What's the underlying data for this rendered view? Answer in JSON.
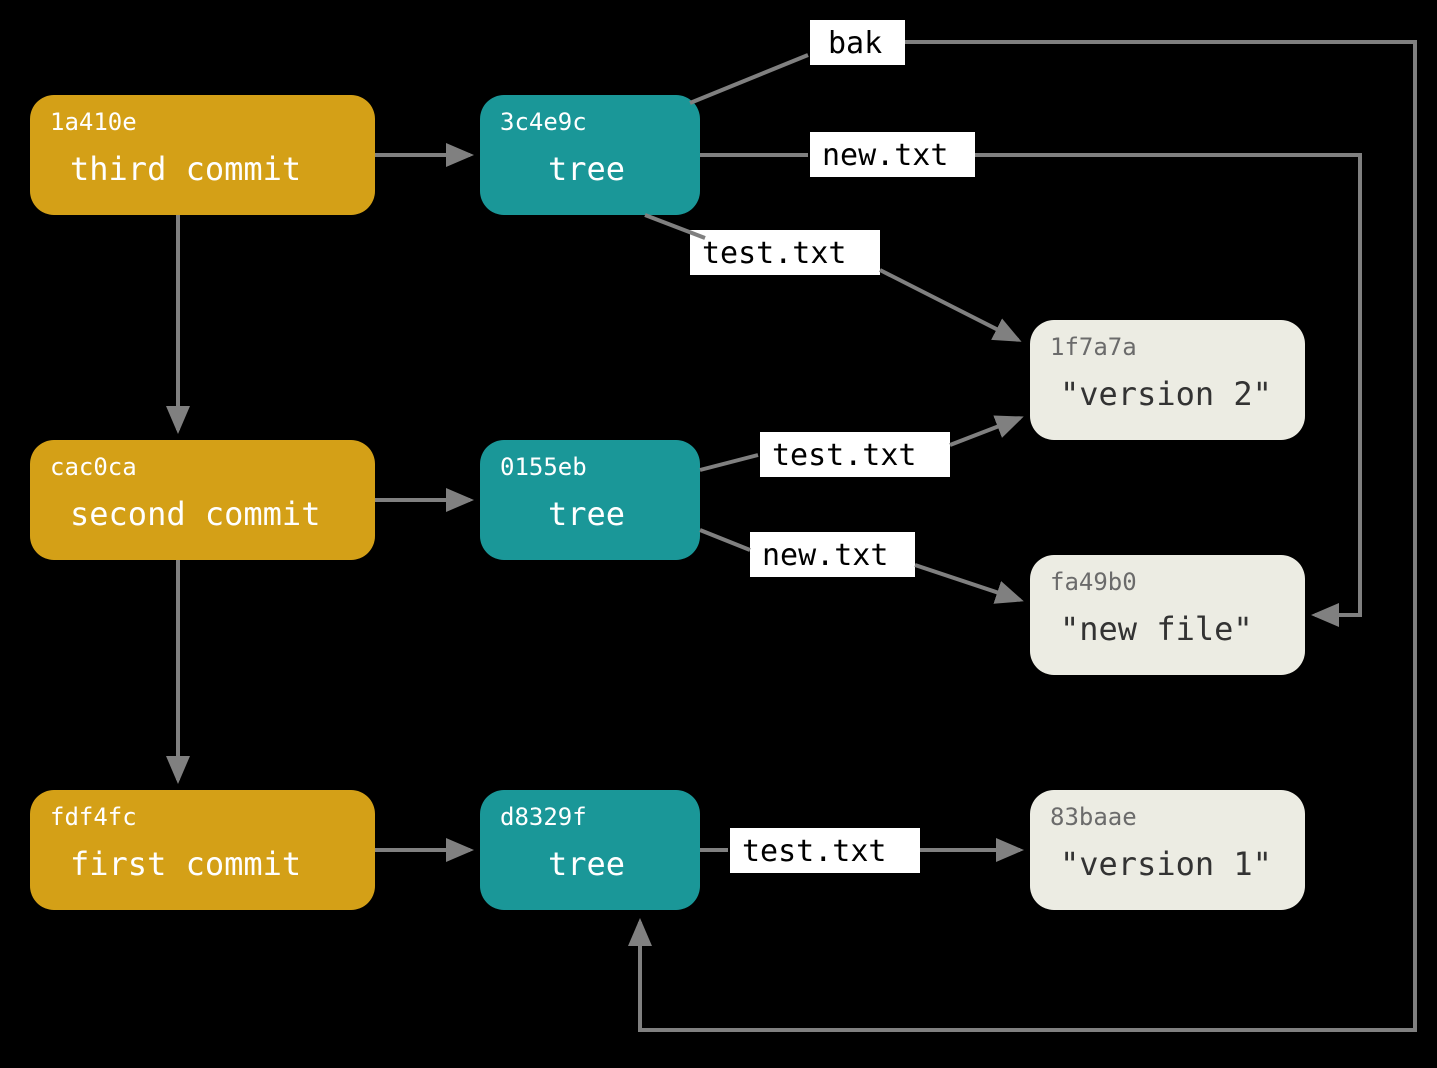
{
  "commits": {
    "third": {
      "hash": "1a410e",
      "label": "third commit"
    },
    "second": {
      "hash": "cac0ca",
      "label": "second commit"
    },
    "first": {
      "hash": "fdf4fc",
      "label": "first commit"
    }
  },
  "trees": {
    "t3": {
      "hash": "3c4e9c",
      "label": "tree"
    },
    "t2": {
      "hash": "0155eb",
      "label": "tree"
    },
    "t1": {
      "hash": "d8329f",
      "label": "tree"
    }
  },
  "blobs": {
    "v2": {
      "hash": "1f7a7a",
      "content": "\"version 2\""
    },
    "nf": {
      "hash": "fa49b0",
      "content": "\"new file\""
    },
    "v1": {
      "hash": "83baae",
      "content": "\"version 1\""
    }
  },
  "labels": {
    "bak": "bak",
    "newtxt": "new.txt",
    "testtxt": "test.txt"
  },
  "colors": {
    "commit": "#d4a017",
    "tree": "#1a9798",
    "blob": "#ecece3",
    "arrow": "#808080"
  }
}
